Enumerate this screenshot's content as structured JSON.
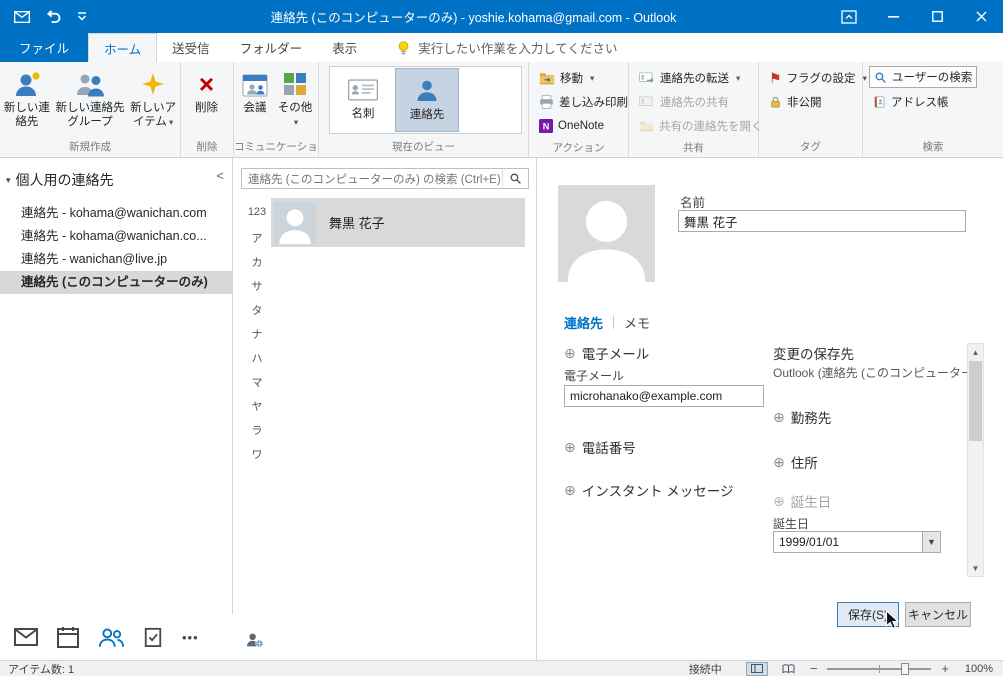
{
  "colors": {
    "accent": "#0072C6",
    "titlebar": "#0072C6",
    "selection": "#d9d9d9"
  },
  "titlebar": {
    "title": "連絡先 (このコンピューターのみ) - yoshie.kohama@gmail.com - Outlook"
  },
  "tabs_row": {
    "file": "ファイル",
    "home": "ホーム",
    "send_receive": "送受信",
    "folder": "フォルダー",
    "view": "表示",
    "tellme": "実行したい作業を入力してください"
  },
  "ribbon": {
    "groups": [
      {
        "label": "新規作成",
        "buttons": [
          {
            "label": "新しい連絡先",
            "icon": "new-contact-icon"
          },
          {
            "label": "新しい連絡先グループ",
            "icon": "new-contact-group-icon"
          },
          {
            "label": "新しいアイテム",
            "icon": "new-items-icon",
            "dropdown": true
          }
        ]
      },
      {
        "label": "削除",
        "buttons": [
          {
            "label": "削除",
            "icon": "delete-icon"
          }
        ]
      },
      {
        "label": "コミュニケーション",
        "buttons": [
          {
            "label": "会議",
            "icon": "meeting-icon"
          },
          {
            "label": "その他",
            "icon": "more-comm-icon",
            "dropdown": true
          }
        ]
      },
      {
        "label": "現在のビュー",
        "gallery": [
          {
            "label": "名刺",
            "icon": "business-card-view-icon",
            "selected": false
          },
          {
            "label": "連絡先",
            "icon": "people-view-icon",
            "selected": true
          }
        ]
      },
      {
        "label": "アクション",
        "buttons": [
          {
            "label": "移動",
            "icon": "move-icon",
            "dropdown": true
          },
          {
            "label": "差し込み印刷",
            "icon": "mail-merge-icon"
          },
          {
            "label": "OneNote",
            "icon": "onenote-icon"
          }
        ]
      },
      {
        "label": "共有",
        "buttons": [
          {
            "label": "連絡先の転送",
            "icon": "forward-contact-icon",
            "dropdown": true
          },
          {
            "label": "連絡先の共有",
            "icon": "share-contact-icon",
            "disabled": true
          },
          {
            "label": "共有の連絡先を開く",
            "icon": "open-shared-contacts-icon",
            "disabled": true
          }
        ]
      },
      {
        "label": "タグ",
        "buttons": [
          {
            "label": "フラグの設定",
            "icon": "flag-icon",
            "dropdown": true
          },
          {
            "label": "非公開",
            "icon": "private-lock-icon"
          }
        ]
      },
      {
        "label": "検索",
        "buttons": [
          {
            "label": "ユーザーの検索",
            "icon": "find-people-icon"
          },
          {
            "label": "アドレス帳",
            "icon": "address-book-icon"
          }
        ]
      }
    ]
  },
  "folder_pane": {
    "header": "個人用の連絡先",
    "items": [
      {
        "label": "連絡先 - kohama@wanichan.com",
        "selected": false
      },
      {
        "label": "連絡先 - kohama@wanichan.co...",
        "selected": false
      },
      {
        "label": "連絡先 - wanichan@live.jp",
        "selected": false
      },
      {
        "label": "連絡先 (このコンピューターのみ)",
        "selected": true
      }
    ]
  },
  "contact_list": {
    "search_placeholder": "連絡先 (このコンピューターのみ) の検索 (Ctrl+E)",
    "index": [
      "123",
      "ア",
      "カ",
      "サ",
      "タ",
      "ナ",
      "ハ",
      "マ",
      "ヤ",
      "ラ",
      "ワ"
    ],
    "contacts": [
      {
        "name": "舞黒 花子",
        "selected": true
      }
    ]
  },
  "contact_form": {
    "name_label": "名前",
    "name_value": "舞黒 花子",
    "tab_contact": "連絡先",
    "tab_notes": "メモ",
    "email_section": "電子メール",
    "email_label": "電子メール",
    "email_value": "microhanako@example.com",
    "phone_section": "電話番号",
    "im_section": "インスタント メッセージ",
    "save_to_label": "変更の保存先",
    "save_to_value": "Outlook (連絡先 (このコンピューター...",
    "work_section": "勤務先",
    "address_section": "住所",
    "birthday_section": "誕生日",
    "birthday_label": "誕生日",
    "birthday_value": "1999/01/01",
    "save_button": "保存(S)",
    "cancel_button": "キャンセル"
  },
  "statusbar": {
    "items_count": "アイテム数: 1",
    "connection": "接続中",
    "zoom": "100%"
  }
}
